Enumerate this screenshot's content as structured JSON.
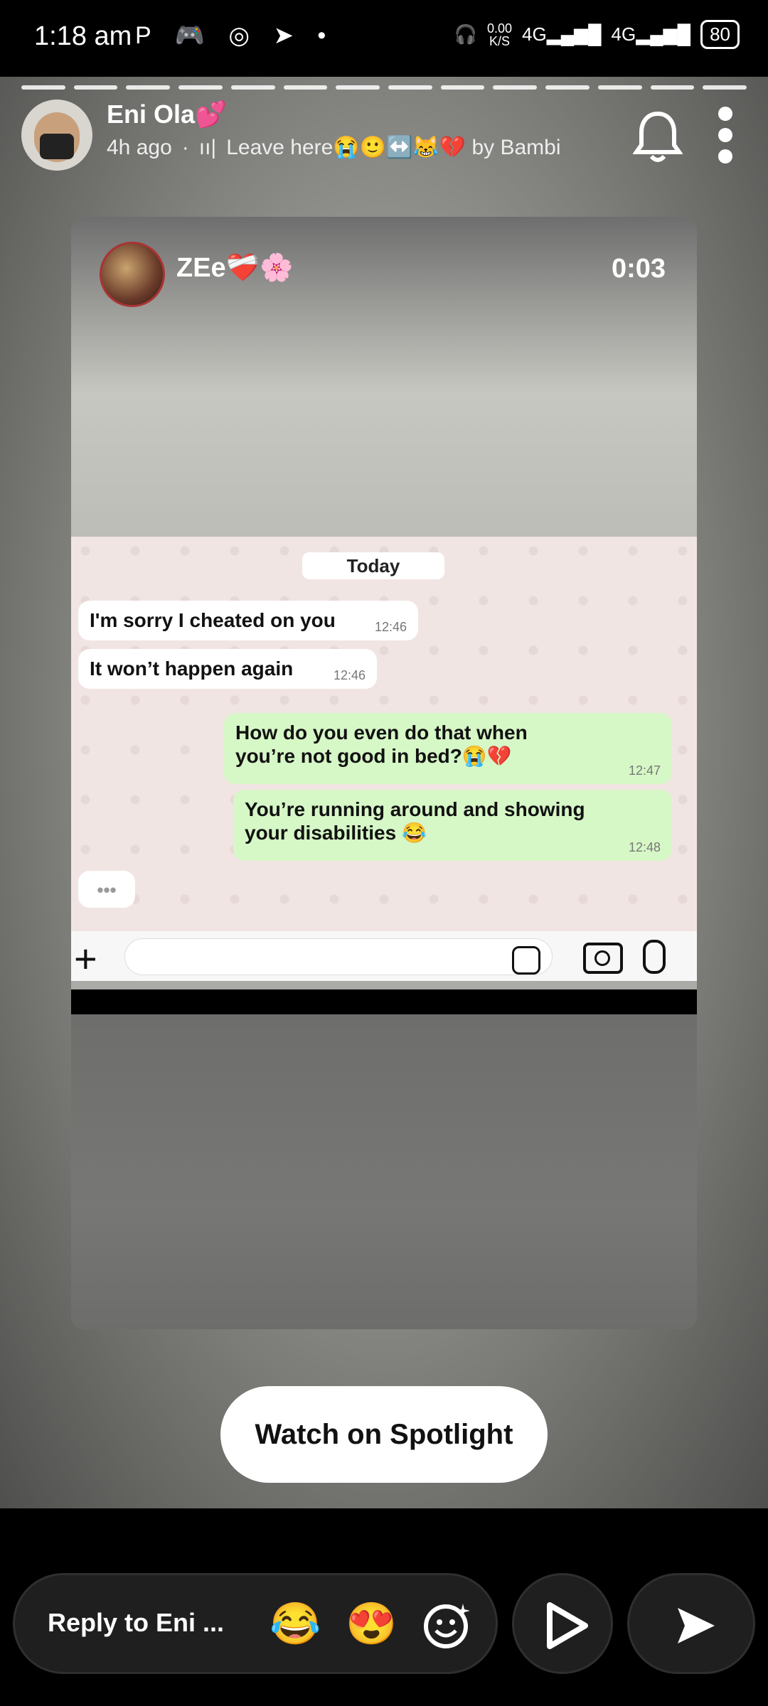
{
  "status_bar": {
    "time": "1:18 am",
    "icons": [
      "P",
      "game-controller",
      "whatsapp",
      "telegram",
      "dot"
    ],
    "net_speed": "0.00",
    "net_unit": "K/S",
    "network_1": "4G",
    "network_2": "4G",
    "battery": "80"
  },
  "story": {
    "username": "Eni Ola💕",
    "time_ago": "4h ago",
    "separator": "·",
    "audio_icon": "ıı|",
    "music": "Leave here😭🙂↔️😹💔 by Bambi",
    "progress_segments": 14
  },
  "video": {
    "poster_name": "ZEe❤️‍🩹🌸",
    "timer": "0:03",
    "chat": {
      "date_label": "Today",
      "messages": [
        {
          "text": "I'm sorry I cheated on you",
          "time": "12:46",
          "sent": false
        },
        {
          "text": "It won’t happen again",
          "time": "12:46",
          "sent": false
        },
        {
          "text": "How do you even do that when you’re not good in bed?😭💔",
          "time": "12:47",
          "sent": true
        },
        {
          "text": "You’re running around and showing your disabilities 😂",
          "time": "12:48",
          "sent": true
        }
      ],
      "typing": "•••",
      "plus": "+"
    }
  },
  "spotlight_button": "Watch on Spotlight",
  "reply_bar": {
    "placeholder": "Reply to Eni ...",
    "emoji_1": "😂",
    "emoji_2": "😍"
  },
  "colors": {
    "chat_bg": "#f1e5e3",
    "sent_bubble": "#d6f7c6",
    "received_bubble": "#ffffff"
  }
}
